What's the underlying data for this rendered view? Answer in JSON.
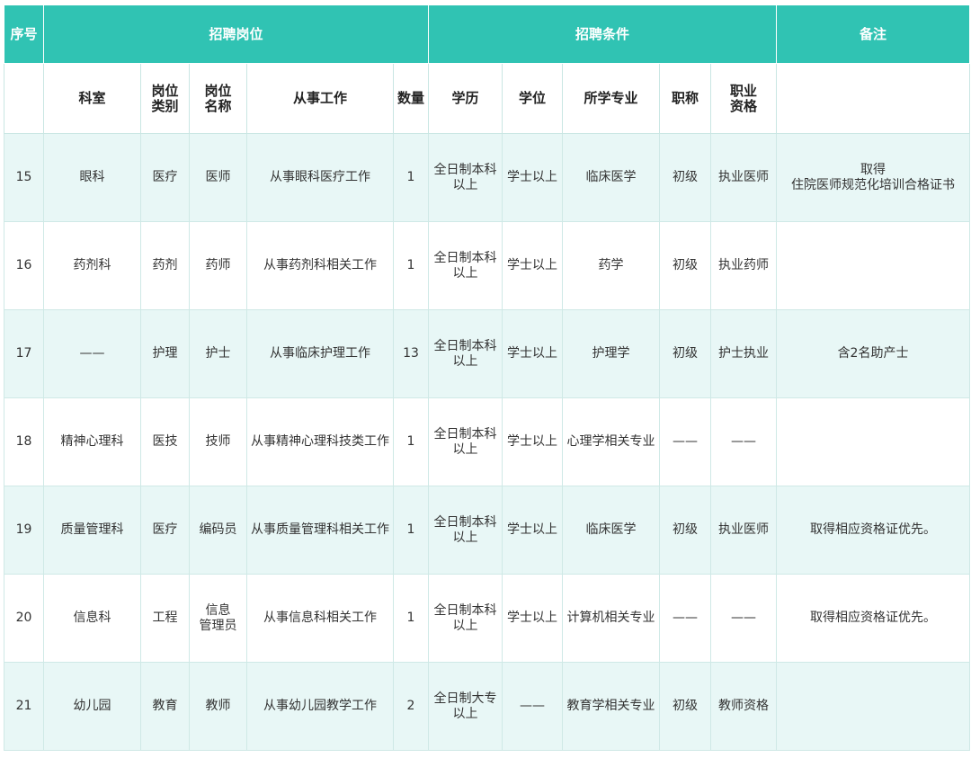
{
  "header": {
    "seq": "序号",
    "group_post": "招聘岗位",
    "group_cond": "招聘条件",
    "remark": "备注"
  },
  "subheader": {
    "dept": "科室",
    "post_type": "岗位\n类别",
    "post_name": "岗位\n名称",
    "work": "从事工作",
    "count": "数量",
    "edu": "学历",
    "degree": "学位",
    "major": "所学专业",
    "title": "职称",
    "qual": "职业\n资格"
  },
  "rows": [
    {
      "seq": "15",
      "dept": "眼科",
      "type": "医疗",
      "name": "医师",
      "work": "从事眼科医疗工作",
      "count": "1",
      "edu": "全日制本科\n以上",
      "degree": "学士以上",
      "major": "临床医学",
      "title": "初级",
      "qual": "执业医师",
      "remark": "取得\n住院医师规范化培训合格证书"
    },
    {
      "seq": "16",
      "dept": "药剂科",
      "type": "药剂",
      "name": "药师",
      "work": "从事药剂科相关工作",
      "count": "1",
      "edu": "全日制本科\n以上",
      "degree": "学士以上",
      "major": "药学",
      "title": "初级",
      "qual": "执业药师",
      "remark": ""
    },
    {
      "seq": "17",
      "dept": "——",
      "type": "护理",
      "name": "护士",
      "work": "从事临床护理工作",
      "count": "13",
      "edu": "全日制本科\n以上",
      "degree": "学士以上",
      "major": "护理学",
      "title": "初级",
      "qual": "护士执业",
      "remark": "含2名助产士"
    },
    {
      "seq": "18",
      "dept": "精神心理科",
      "type": "医技",
      "name": "技师",
      "work": "从事精神心理科技类工作",
      "count": "1",
      "edu": "全日制本科\n以上",
      "degree": "学士以上",
      "major": "心理学相关专业",
      "title": "——",
      "qual": "——",
      "remark": ""
    },
    {
      "seq": "19",
      "dept": "质量管理科",
      "type": "医疗",
      "name": "编码员",
      "work": "从事质量管理科相关工作",
      "count": "1",
      "edu": "全日制本科\n以上",
      "degree": "学士以上",
      "major": "临床医学",
      "title": "初级",
      "qual": "执业医师",
      "remark": "取得相应资格证优先。"
    },
    {
      "seq": "20",
      "dept": "信息科",
      "type": "工程",
      "name": "信息\n管理员",
      "work": "从事信息科相关工作",
      "count": "1",
      "edu": "全日制本科\n以上",
      "degree": "学士以上",
      "major": "计算机相关专业",
      "title": "——",
      "qual": "——",
      "remark": "取得相应资格证优先。"
    },
    {
      "seq": "21",
      "dept": "幼儿园",
      "type": "教育",
      "name": "教师",
      "work": "从事幼儿园教学工作",
      "count": "2",
      "edu": "全日制大专\n以上",
      "degree": "——",
      "major": "教育学相关专业",
      "title": "初级",
      "qual": "教师资格",
      "remark": ""
    }
  ]
}
